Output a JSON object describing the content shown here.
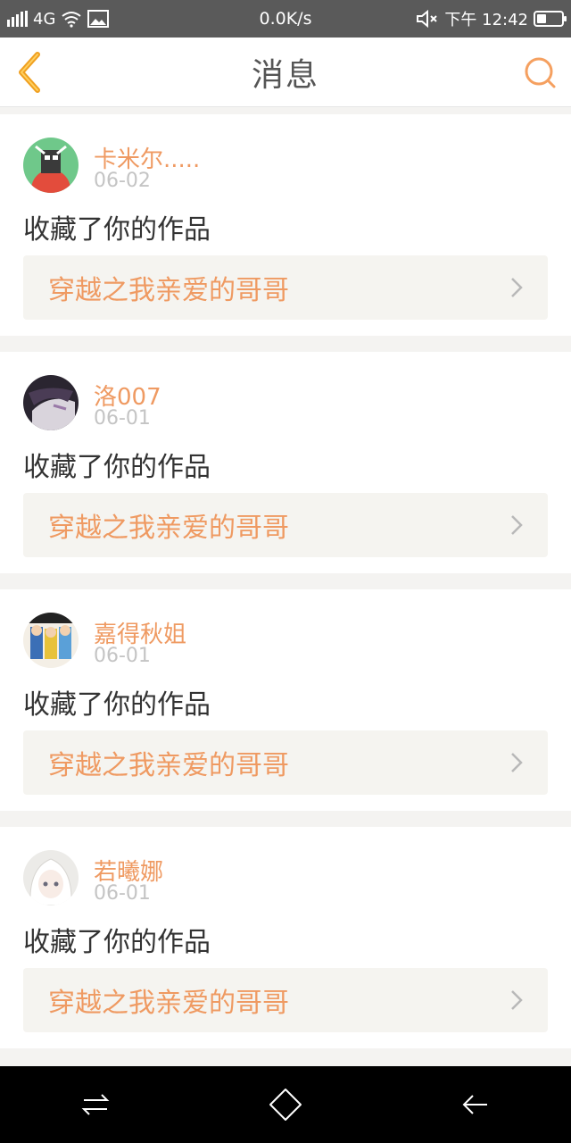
{
  "status_bar": {
    "network": "4G",
    "speed": "0.0K/s",
    "time": "下午 12:42"
  },
  "header": {
    "title": "消息"
  },
  "messages": [
    {
      "username": "卡米尔.....",
      "date": "06-02",
      "action": "收藏了你的作品",
      "work_title": "穿越之我亲爱的哥哥"
    },
    {
      "username": "洛007",
      "date": "06-01",
      "action": "收藏了你的作品",
      "work_title": "穿越之我亲爱的哥哥"
    },
    {
      "username": "嘉得秋姐",
      "date": "06-01",
      "action": "收藏了你的作品",
      "work_title": "穿越之我亲爱的哥哥"
    },
    {
      "username": "若曦娜",
      "date": "06-01",
      "action": "收藏了你的作品",
      "work_title": "穿越之我亲爱的哥哥"
    }
  ],
  "colors": {
    "accent": "#ef9a62",
    "back_arrow": "#f0a020"
  }
}
